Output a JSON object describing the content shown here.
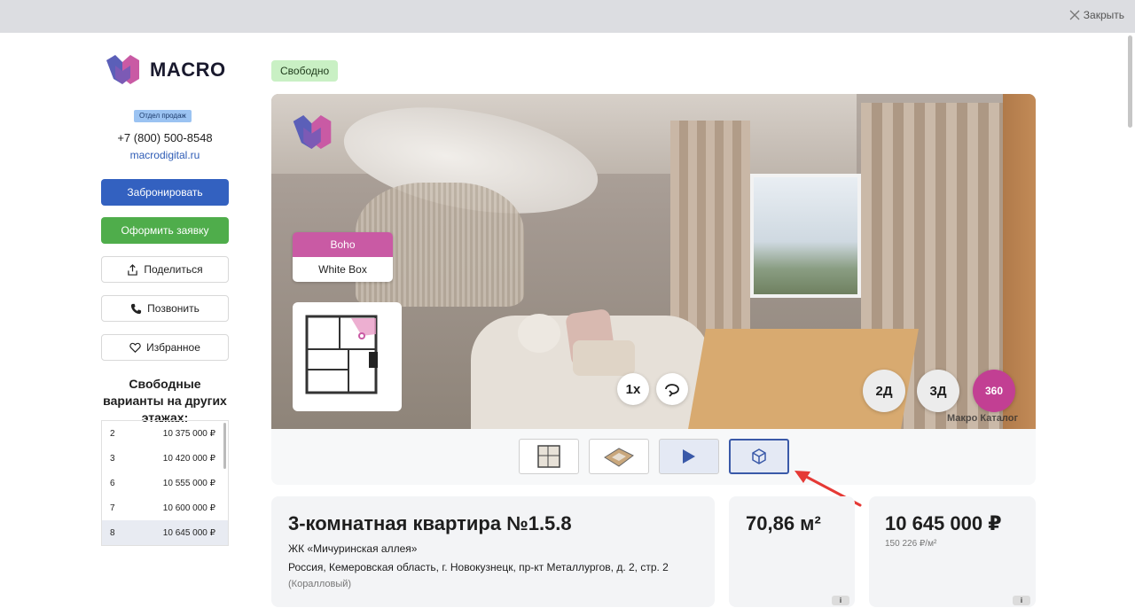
{
  "topbar": {
    "close_label": "Закрыть"
  },
  "brand": {
    "name": "MACRO"
  },
  "contacts": {
    "department": "Отдел продаж",
    "phone": "+7 (800) 500-8548",
    "website": "macrodigital.ru"
  },
  "actions": {
    "book": "Забронировать",
    "apply": "Оформить заявку",
    "share": "Поделиться",
    "call": "Позвонить",
    "favorite": "Избранное"
  },
  "other_floors": {
    "title": "Свободные варианты на других этажах:",
    "rows": [
      {
        "floor": "2",
        "price": "10 375 000 ₽"
      },
      {
        "floor": "3",
        "price": "10 420 000 ₽"
      },
      {
        "floor": "6",
        "price": "10 555 000 ₽"
      },
      {
        "floor": "7",
        "price": "10 600 000 ₽"
      },
      {
        "floor": "8",
        "price": "10 645 000 ₽",
        "selected": true
      }
    ]
  },
  "status": "Свободно",
  "viewer": {
    "styles": [
      {
        "label": "Boho",
        "active": true
      },
      {
        "label": "White Box",
        "active": false
      }
    ],
    "speed": "1x",
    "modes": {
      "two_d": "2Д",
      "three_d": "3Д",
      "pano": "360"
    },
    "watermark": "Макро Каталог",
    "thumbnails": [
      "floorplan-2d",
      "floorplan-3d",
      "video",
      "3d-tour"
    ]
  },
  "apartment": {
    "title": "3-комнатная квартира №1.5.8",
    "complex": "ЖК «Мичуринская аллея»",
    "address": "Россия, Кемеровская область, г. Новокузнецк, пр-кт Металлургов, д. 2, стр. 2",
    "color": "(Коралловый)",
    "area": "70,86 м²",
    "price": "10 645 000 ₽",
    "price_per_m2": "150 226 ₽/м²",
    "info_badge": "i"
  },
  "colors": {
    "primary": "#3361c0",
    "success": "#4fad4b",
    "accent": "#c23f93",
    "status_bg": "#c9f0c4"
  }
}
